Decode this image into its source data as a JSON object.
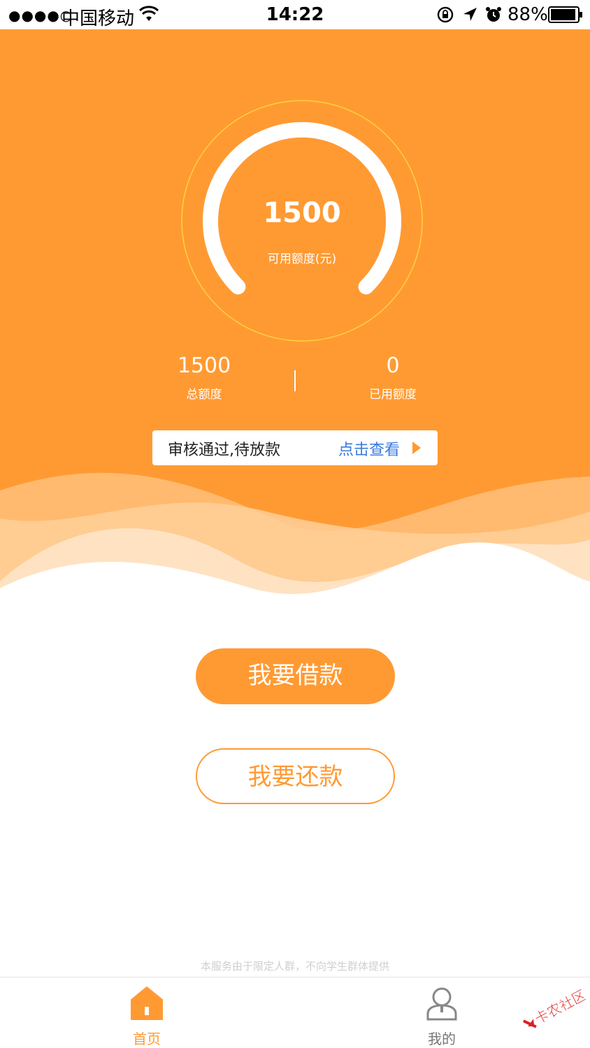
{
  "status_bar": {
    "signal": "●●●●○",
    "carrier": "中国移动",
    "time": "14:22",
    "battery": "88%"
  },
  "credit": {
    "available_amount": "1500",
    "available_label": "可用额度(元)",
    "total_amount": "1500",
    "total_label": "总额度",
    "used_amount": "0",
    "used_label": "已用额度"
  },
  "notice": {
    "status_text": "审核通过,待放款",
    "link_text": "点击查看"
  },
  "actions": {
    "borrow_label": "我要借款",
    "repay_label": "我要还款"
  },
  "footnote": "本服务由于限定人群，不向学生群体提供",
  "tabs": [
    {
      "label": "首页",
      "icon": "home-icon",
      "active": true
    },
    {
      "label": "我的",
      "icon": "user-icon",
      "active": false
    }
  ],
  "watermark": "卡农社区",
  "colors": {
    "brand_orange": "#ff9a33",
    "link_blue": "#3a7ae0"
  }
}
